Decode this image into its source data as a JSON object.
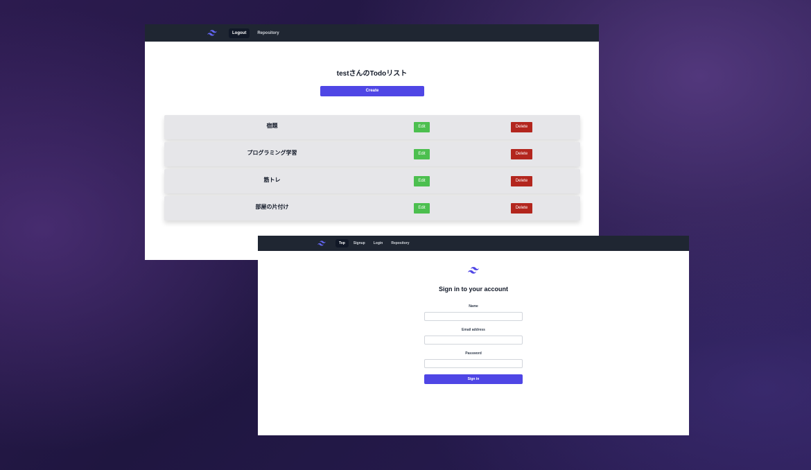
{
  "colors": {
    "navbar": "#1f2632",
    "accent": "#4f46e5",
    "edit": "#4cbf4f",
    "delete": "#b3261e",
    "logo": "#6366f1"
  },
  "todo_page": {
    "nav": {
      "logo_icon": "tailwind-wave-icon",
      "logout_label": "Logout",
      "repository_label": "Repository"
    },
    "title": "testさんのTodoリスト",
    "create_label": "Create",
    "todos": [
      {
        "name": "宿題",
        "edit_label": "Edit",
        "delete_label": "Delete"
      },
      {
        "name": "プログラミング学習",
        "edit_label": "Edit",
        "delete_label": "Delete"
      },
      {
        "name": "筋トレ",
        "edit_label": "Edit",
        "delete_label": "Delete"
      },
      {
        "name": "部屋の片付け",
        "edit_label": "Edit",
        "delete_label": "Delete"
      }
    ]
  },
  "signin_page": {
    "nav": {
      "logo_icon": "tailwind-wave-icon",
      "top_label": "Top",
      "signup_label": "Signup",
      "login_label": "Login",
      "repository_label": "Repository"
    },
    "title": "Sign in to your account",
    "name_label": "Name",
    "name_value": "",
    "email_label": "Email address",
    "email_value": "",
    "password_label": "Password",
    "password_value": "",
    "submit_label": "Sign in"
  }
}
